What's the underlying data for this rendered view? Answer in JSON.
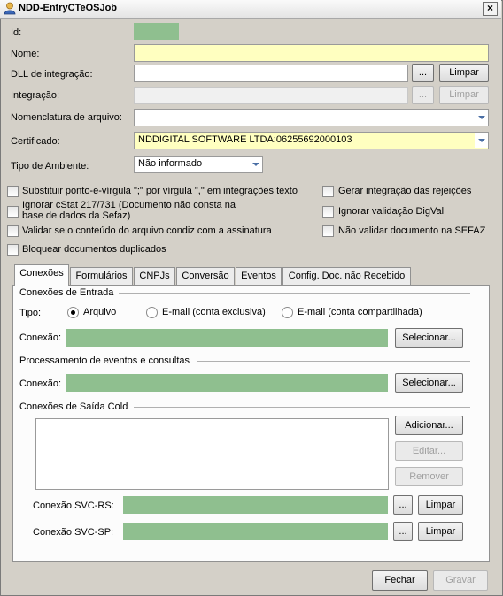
{
  "window": {
    "title": "NDD-EntryCTeOSJob",
    "close_glyph": "×"
  },
  "form": {
    "id_label": "Id:",
    "nome_label": "Nome:",
    "nome_value": "",
    "dll_label": "DLL de integração:",
    "dll_value": "",
    "browse_glyph": "...",
    "limpar_label": "Limpar",
    "integracao_label": "Integração:",
    "integracao_value": "",
    "nomenclatura_label": "Nomenclatura de arquivo:",
    "nomenclatura_value": "",
    "certificado_label": "Certificado:",
    "certificado_value": "NDDIGITAL SOFTWARE LTDA:06255692000103",
    "tipo_ambiente_label": "Tipo de Ambiente:",
    "tipo_ambiente_value": "Não informado"
  },
  "options": {
    "substituir": "Substituir ponto-e-vírgula \";\" por vírgula \",\" em integrações texto",
    "ignorar_cstat_line1": "Ignorar cStat 217/731 (Documento não consta na",
    "ignorar_cstat_line2": "base de dados da Sefaz)",
    "validar": "Validar se o conteúdo do arquivo condiz com a assinatura",
    "bloquear": "Bloquear documentos duplicados",
    "gerar_rejeicoes": "Gerar integração das rejeições",
    "ignorar_digval": "Ignorar validação DigVal",
    "nao_validar": "Não validar documento na SEFAZ"
  },
  "tabs": [
    "Conexões",
    "Formulários",
    "CNPJs",
    "Conversão",
    "Eventos",
    "Config. Doc. não Recebido"
  ],
  "conexoes": {
    "entrada_title": "Conexões de Entrada",
    "tipo_label": "Tipo:",
    "radio_arquivo": "Arquivo",
    "radio_email_excl": "E-mail (conta exclusiva)",
    "radio_email_comp": "E-mail (conta compartilhada)",
    "conexao_label": "Conexão:",
    "selecionar_label": "Selecionar...",
    "processamento_title": "Processamento de eventos e consultas",
    "saida_title": "Conexões de Saída Cold",
    "adicionar_label": "Adicionar...",
    "editar_label": "Editar...",
    "remover_label": "Remover",
    "svc_rs_label": "Conexão SVC-RS:",
    "svc_sp_label": "Conexão SVC-SP:"
  },
  "footer": {
    "fechar_label": "Fechar",
    "gravar_label": "Gravar"
  },
  "colors": {
    "green_field": "#8fbf8f",
    "yellow_field": "#ffffc0",
    "dialog_bg": "#d4d0c8"
  }
}
